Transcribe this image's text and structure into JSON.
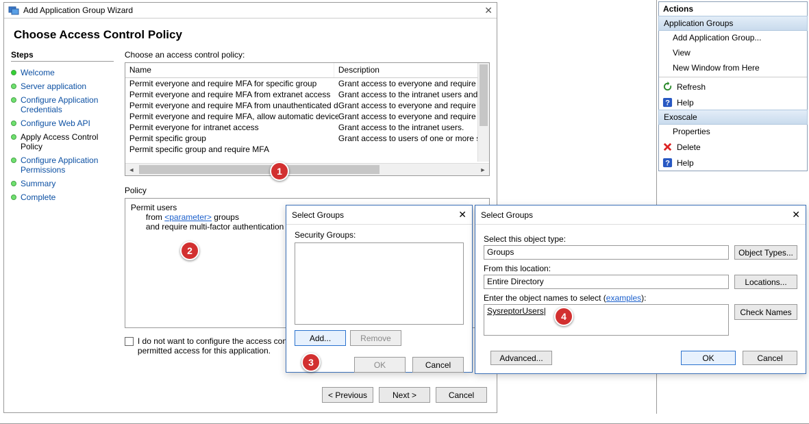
{
  "wizard": {
    "title": "Add Application Group Wizard",
    "heading": "Choose Access Control Policy",
    "close_glyph": "✕",
    "steps_header": "Steps",
    "steps": [
      {
        "label": "Welcome"
      },
      {
        "label": "Server application"
      },
      {
        "label": "Configure Application Credentials"
      },
      {
        "label": "Configure Web API"
      },
      {
        "label": "Apply Access Control Policy",
        "selected": true
      },
      {
        "label": "Configure Application Permissions"
      },
      {
        "label": "Summary"
      },
      {
        "label": "Complete"
      }
    ],
    "policy_list_label": "Choose an access control policy:",
    "col_name": "Name",
    "col_desc": "Description",
    "policies": [
      {
        "name": "Permit everyone and require MFA for specific group",
        "desc": "Grant access to everyone and require M"
      },
      {
        "name": "Permit everyone and require MFA from extranet access",
        "desc": "Grant access to the intranet users and r"
      },
      {
        "name": "Permit everyone and require MFA from unauthenticated devices",
        "desc": "Grant access to everyone and require M"
      },
      {
        "name": "Permit everyone and require MFA, allow automatic device regi...",
        "desc": "Grant access to everyone and require M"
      },
      {
        "name": "Permit everyone for intranet access",
        "desc": "Grant access to the intranet users."
      },
      {
        "name": "Permit specific group",
        "desc": "Grant access to users of one or more sp"
      },
      {
        "name": "Permit specific group and require MFA",
        "desc": ""
      }
    ],
    "policy_label": "Policy",
    "policy_line1": "Permit users",
    "policy_line2_pre": "from ",
    "policy_param": "<parameter>",
    "policy_line2_post": " groups",
    "policy_line3": "and require multi-factor authentication",
    "chk_text": "I do not want to configure the access control policy at this time. No users will be permitted access for this application.",
    "btn_prev": "< Previous",
    "btn_next": "Next >",
    "btn_cancel": "Cancel"
  },
  "dlg1": {
    "title": "Select Groups",
    "label": "Security Groups:",
    "btn_add": "Add...",
    "btn_remove": "Remove",
    "btn_ok": "OK",
    "btn_cancel": "Cancel"
  },
  "dlg2": {
    "title": "Select Groups",
    "lbl_type": "Select this object type:",
    "val_type": "Groups",
    "btn_types": "Object Types...",
    "lbl_loc": "From this location:",
    "val_loc": "Entire Directory",
    "btn_loc": "Locations...",
    "lbl_names_pre": "Enter the object names to select (",
    "lbl_names_link": "examples",
    "lbl_names_post": "):",
    "val_names": "SysreptorUsers",
    "btn_check": "Check Names",
    "btn_adv": "Advanced...",
    "btn_ok": "OK",
    "btn_cancel": "Cancel"
  },
  "actions": {
    "title": "Actions",
    "section1": "Application Groups",
    "items1": [
      "Add Application Group...",
      "View",
      "New Window from Here",
      "Refresh",
      "Help"
    ],
    "section2": "Exoscale",
    "items2": [
      "Properties",
      "Delete",
      "Help"
    ]
  },
  "marks": {
    "m1": "1",
    "m2": "2",
    "m3": "3",
    "m4": "4"
  }
}
